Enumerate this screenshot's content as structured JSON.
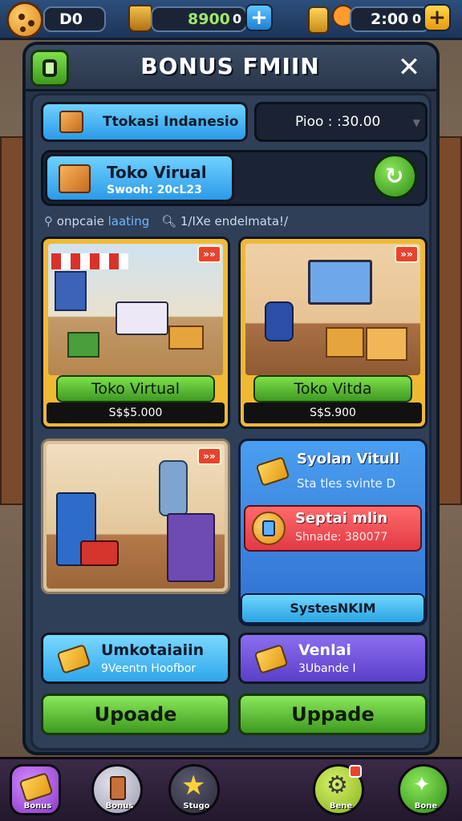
{
  "top_bar": {
    "level_value": "D0",
    "coins_value": "8900",
    "coins_suffix": "0",
    "gems_value": "2:00",
    "gems_suffix": "0",
    "plus_symbol": "+"
  },
  "panel": {
    "title": "BONUS FMIIN",
    "close_symbol": "✕"
  },
  "row1": {
    "region_label": "Ttokasi Indanesio",
    "timer_label": "Pioo : :30.00"
  },
  "featured": {
    "title": "Toko Virual",
    "subtitle": "Swooh: 20cL23"
  },
  "info_line": {
    "left": "onpcaie",
    "left_link": "laating",
    "right": "1/IXe endelmata!/"
  },
  "cards": [
    {
      "label": "Toko Virtual",
      "price": "S$$5.000",
      "badge": "»»"
    },
    {
      "label": "Toko Vitda",
      "price": "S$S.900",
      "badge": "»»"
    },
    {
      "badge": "»»"
    }
  ],
  "side_panel": {
    "item1_title": "Syolan Vitull",
    "item1_sub": "Sta tles svinte D",
    "item2_title": "Septai mlin",
    "item2_sub": "Shnade: 380077",
    "footer": "SystesNKIM"
  },
  "small_cards": [
    {
      "title": "Umkotaiaiin",
      "sub": "9Veentn Hoofbor"
    },
    {
      "title": "Venlai",
      "sub": "3Ubande I"
    }
  ],
  "buttons": {
    "left": "Upoade",
    "right": "Uppade"
  },
  "bottom_nav": [
    {
      "label": "Bonus"
    },
    {
      "label": "Bonus"
    },
    {
      "label": "Stugo"
    },
    {
      "label": "Bene"
    },
    {
      "label": "Bone"
    }
  ]
}
